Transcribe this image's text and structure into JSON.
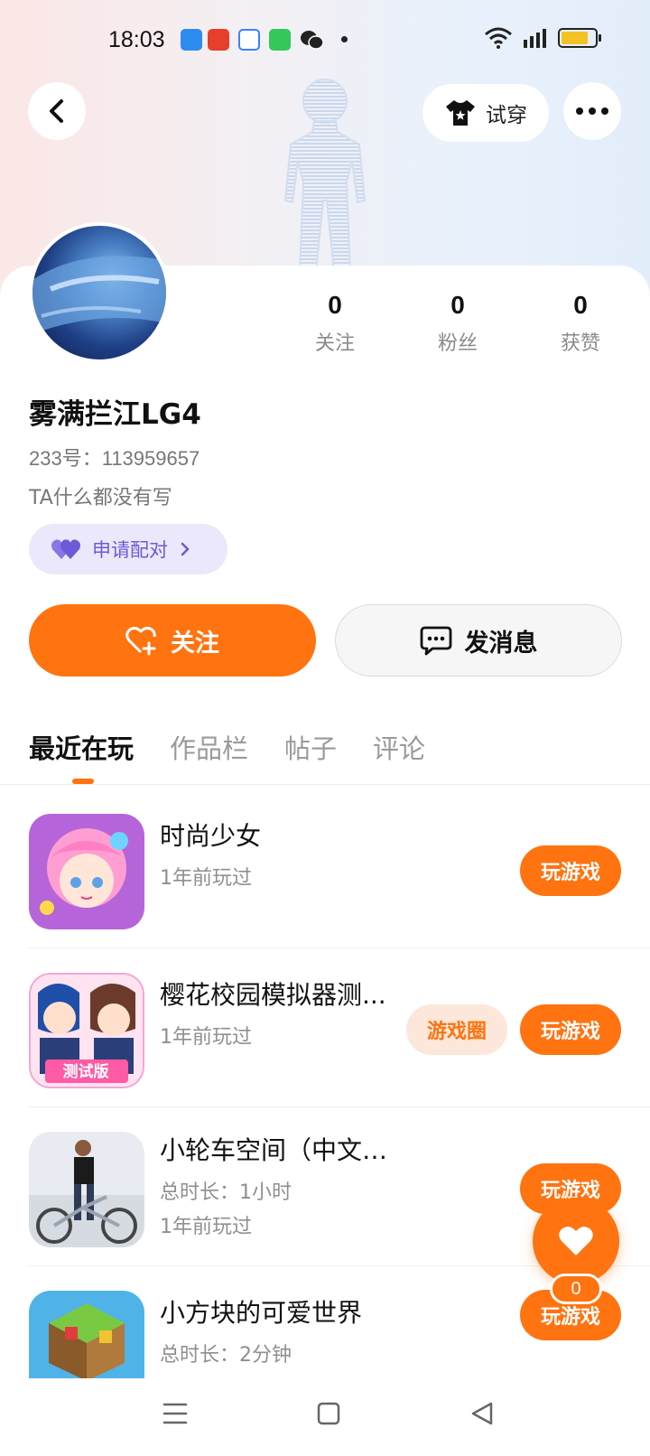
{
  "status_bar": {
    "time": "18:03",
    "notif_icons": [
      "dingtalk-icon",
      "tingshu-icon",
      "calendar-icon",
      "wechat-mini-icon",
      "wechat-icon"
    ],
    "battery_level": 0.8
  },
  "header": {
    "try_on_label": "试穿"
  },
  "profile": {
    "name": "雾满拦江LG4",
    "id_text": "233号：113959657",
    "bio": "TA什么都没有写",
    "pair_label": "申请配对",
    "stats": [
      {
        "value": "0",
        "label": "关注"
      },
      {
        "value": "0",
        "label": "粉丝"
      },
      {
        "value": "0",
        "label": "获赞"
      }
    ]
  },
  "actions": {
    "follow_label": "关注",
    "message_label": "发消息"
  },
  "tabs": [
    "最近在玩",
    "作品栏",
    "帖子",
    "评论"
  ],
  "games": [
    {
      "title": "时尚少女",
      "lines": [
        "1年前玩过"
      ],
      "play": "玩游戏",
      "circle": ""
    },
    {
      "title": "樱花校园模拟器测...",
      "lines": [
        "1年前玩过"
      ],
      "play": "玩游戏",
      "circle": "游戏圈",
      "badge": "测试版"
    },
    {
      "title": "小轮车空间（中文版）",
      "lines": [
        "总时长：1小时",
        "1年前玩过"
      ],
      "play": "玩游戏",
      "circle": ""
    },
    {
      "title": "小方块的可爱世界",
      "lines": [
        "总时长：2分钟"
      ],
      "play": "玩游戏",
      "circle": ""
    }
  ],
  "fab": {
    "count": "0"
  },
  "colors": {
    "accent": "#ff7310",
    "pair_bg": "#ebe8fb",
    "pair_text": "#6b5bd6"
  }
}
